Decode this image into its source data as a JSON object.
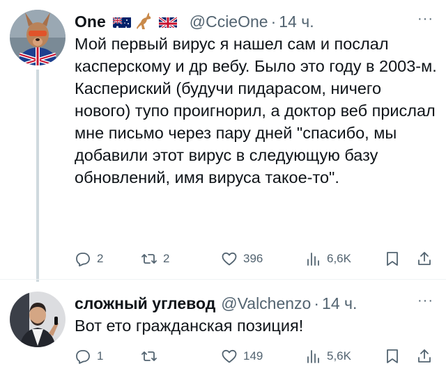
{
  "tweets": [
    {
      "author_name": "One",
      "flags": [
        "australia-flag",
        "kangaroo-emoji",
        "uk-flag"
      ],
      "handle": "@CcieOne",
      "separator": "·",
      "time": "14 ч.",
      "text": "Мой первый вирус я нашел сам и послал касперскому и др вебу. Было это году в 2003-м.\nКаспериский (будучи пидарасом, ничего нового) тупо проигнорил, а доктор веб прислал мне письмо через пару дней \"спасибо, мы добавили этот вирус в следующую базу обновлений, имя вируса такое-то\".",
      "replies": "2",
      "retweets": "2",
      "likes": "396",
      "views": "6,6K"
    },
    {
      "author_name": "сложный углевод",
      "handle": "@Valchenzo",
      "separator": "·",
      "time": "14 ч.",
      "text": "Вот ето гражданская позиция!",
      "replies": "1",
      "retweets": "",
      "likes": "149",
      "views": "5,6K"
    }
  ],
  "icons": {
    "reply": "reply-icon",
    "retweet": "retweet-icon",
    "like": "heart-icon",
    "views": "views-chart-icon",
    "bookmark": "bookmark-icon",
    "share": "share-icon",
    "more": "more-dots-icon"
  },
  "colors": {
    "text": "#0f1419",
    "secondary": "#536471",
    "thread_line": "#cfd9de"
  }
}
